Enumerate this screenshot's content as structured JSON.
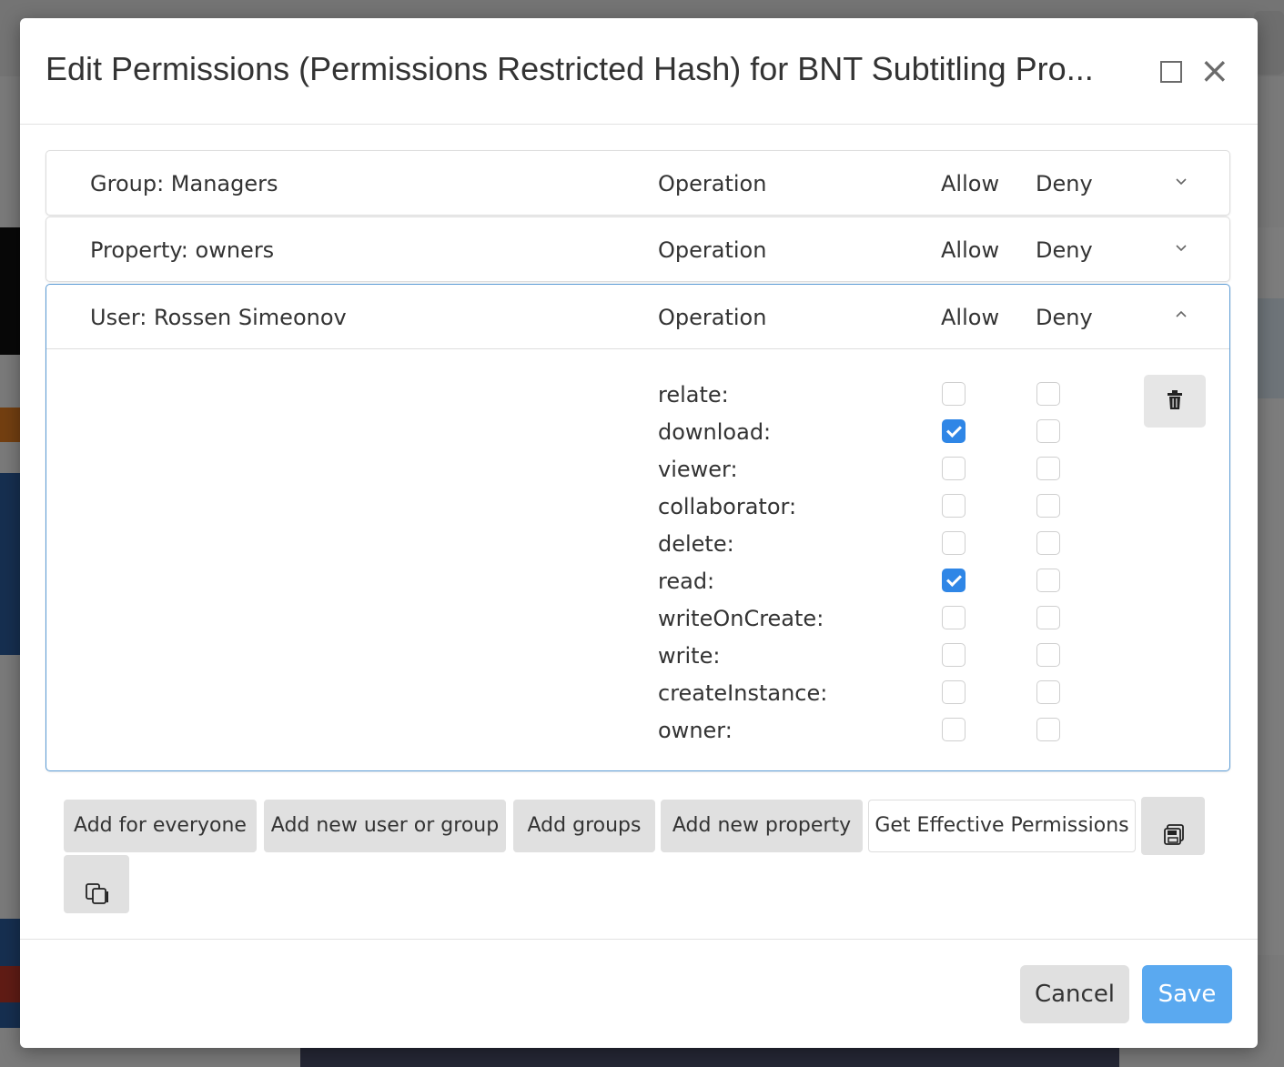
{
  "modal": {
    "title": "Edit Permissions (Permissions Restricted Hash) for BNT Subtitling Pro...",
    "maximize_icon": "square-icon",
    "close_icon": "×"
  },
  "columns": {
    "operation": "Operation",
    "allow": "Allow",
    "deny": "Deny"
  },
  "panels": [
    {
      "label": "Group: Managers",
      "expanded": false,
      "chevron": "chevron-down-icon"
    },
    {
      "label": "Property: owners",
      "expanded": false,
      "chevron": "chevron-down-icon"
    },
    {
      "label": "User: Rossen Simeonov",
      "expanded": true,
      "chevron": "chevron-up-icon"
    }
  ],
  "permissions": [
    {
      "name": "relate:",
      "allow": false,
      "deny": false
    },
    {
      "name": "download:",
      "allow": true,
      "deny": false
    },
    {
      "name": "viewer:",
      "allow": false,
      "deny": false
    },
    {
      "name": "collaborator:",
      "allow": false,
      "deny": false
    },
    {
      "name": "delete:",
      "allow": false,
      "deny": false
    },
    {
      "name": "read:",
      "allow": true,
      "deny": false
    },
    {
      "name": "writeOnCreate:",
      "allow": false,
      "deny": false
    },
    {
      "name": "write:",
      "allow": false,
      "deny": false
    },
    {
      "name": "createInstance:",
      "allow": false,
      "deny": false
    },
    {
      "name": "owner:",
      "allow": false,
      "deny": false
    }
  ],
  "actions": {
    "add_everyone": "Add for everyone",
    "add_user_group": "Add new user or group",
    "add_groups": "Add groups",
    "add_property": "Add new property",
    "effective": "Get Effective Permissions",
    "save_icon": "floppy-disks-icon",
    "copy_icon": "copy-icon",
    "trash_icon": "trash-icon"
  },
  "footer": {
    "cancel": "Cancel",
    "save": "Save"
  },
  "colors": {
    "accent": "#2f86e6",
    "save": "#5aa9f0",
    "active_border": "#5b9bd5"
  }
}
